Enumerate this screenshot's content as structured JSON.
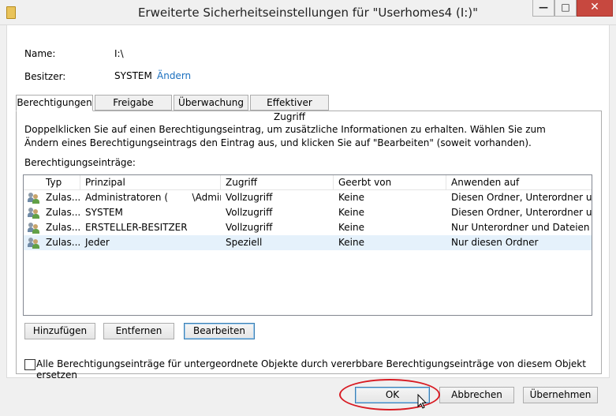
{
  "window": {
    "title": "Erweiterte Sicherheitseinstellungen für \"Userhomes4 (I:)\"",
    "min_glyph": "—",
    "max_glyph": "□",
    "close_glyph": "✕"
  },
  "info": {
    "name_label": "Name:",
    "name_value": "I:\\",
    "owner_label": "Besitzer:",
    "owner_value": "SYSTEM",
    "change_link": "Ändern"
  },
  "tabs": [
    {
      "label": "Berechtigungen",
      "active": true
    },
    {
      "label": "Freigabe",
      "active": false
    },
    {
      "label": "Überwachung",
      "active": false
    },
    {
      "label": "Effektiver Zugriff",
      "active": false
    }
  ],
  "description": "Doppelklicken Sie auf einen Berechtigungseintrag, um zusätzliche Informationen zu erhalten. Wählen Sie zum Ändern eines Berechtigungseintrags den Eintrag aus, und klicken Sie auf \"Bearbeiten\" (soweit vorhanden).",
  "entries_label": "Berechtigungseinträge:",
  "columns": [
    "Typ",
    "Prinzipal",
    "Zugriff",
    "Geerbt von",
    "Anwenden auf"
  ],
  "rows": [
    {
      "typ": "Zulas...",
      "prinzipal": "Administratoren (        \\Admin...",
      "zugriff": "Vollzugriff",
      "geerbt": "Keine",
      "anwenden": "Diesen Ordner, Unterordner un...",
      "selected": false
    },
    {
      "typ": "Zulas...",
      "prinzipal": "SYSTEM",
      "zugriff": "Vollzugriff",
      "geerbt": "Keine",
      "anwenden": "Diesen Ordner, Unterordner un...",
      "selected": false
    },
    {
      "typ": "Zulas...",
      "prinzipal": "ERSTELLER-BESITZER",
      "zugriff": "Vollzugriff",
      "geerbt": "Keine",
      "anwenden": "Nur Unterordner und Dateien",
      "selected": false
    },
    {
      "typ": "Zulas...",
      "prinzipal": "Jeder",
      "zugriff": "Speziell",
      "geerbt": "Keine",
      "anwenden": "Nur diesen Ordner",
      "selected": true
    }
  ],
  "buttons": {
    "add": "Hinzufügen",
    "remove": "Entfernen",
    "edit": "Bearbeiten",
    "ok": "OK",
    "cancel": "Abbrechen",
    "apply": "Übernehmen"
  },
  "replace_checkbox": {
    "label": "Alle Berechtigungseinträge für untergeordnete Objekte durch vererbbare Berechtigungseinträge von diesem Objekt ersetzen",
    "checked": false
  },
  "colors": {
    "link": "#1a6fbf",
    "highlight_ellipse": "#d81b23",
    "selected_row": "#e5f1fb"
  }
}
